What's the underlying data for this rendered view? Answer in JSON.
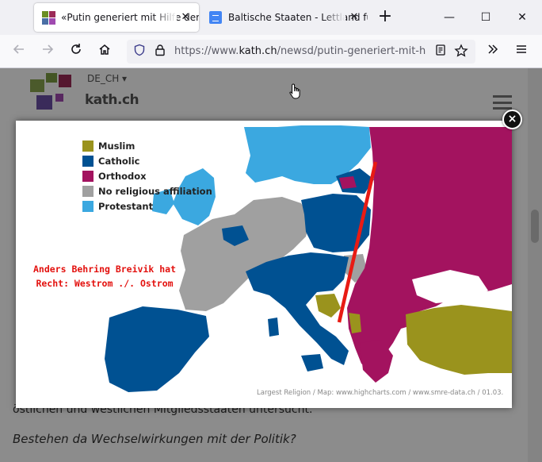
{
  "browser": {
    "tabs": [
      {
        "title": "«Putin generiert mit Hilfe der",
        "active": true
      },
      {
        "title": "Baltische Staaten - Lettland fü",
        "active": false
      }
    ],
    "new_tab_label": "+",
    "window_controls": {
      "minimize": "—",
      "maximize": "☐",
      "close": "✕"
    },
    "url": {
      "prefix": "https://www.",
      "host": "kath.ch",
      "path": "/newsd/putin-generiert-mit-hilfe"
    },
    "icons": [
      "back-icon",
      "forward-icon",
      "reload-icon",
      "home-icon",
      "shield-icon",
      "lock-icon",
      "reader-icon",
      "bookmark-star-icon",
      "overflow-chevron-icon",
      "menu-icon"
    ]
  },
  "site": {
    "language": "DE_CH",
    "brand": "kath.ch",
    "colors": {
      "logo": [
        "#6b8e23",
        "#9c2a57",
        "#4a6fa5",
        "#a04ab0"
      ]
    },
    "background_text": [
      {
        "text": "östlichen und westlichen Mitgliedsstaaten untersucht.",
        "style": "normal"
      },
      {
        "text": "Bestehen da Wechselwirkungen mit der Politik?",
        "style": "italic"
      }
    ]
  },
  "lightbox": {
    "close_label": "×",
    "map": {
      "legend": [
        {
          "label": "Muslim",
          "color": "#9a931d"
        },
        {
          "label": "Catholic",
          "color": "#005192"
        },
        {
          "label": "Orthodox",
          "color": "#a3135f"
        },
        {
          "label": "No religious affiliation",
          "color": "#a0a0a0"
        },
        {
          "label": "Protestant",
          "color": "#3ba8e0"
        }
      ],
      "annotation": [
        "Anders Behring Breivik hat",
        "Recht: Westrom ./. Ostrom"
      ],
      "divider_color": "#e81b14",
      "credit": "Largest Religion / Map: www.highcharts.com / www.smre-data.ch / 01.03."
    }
  }
}
